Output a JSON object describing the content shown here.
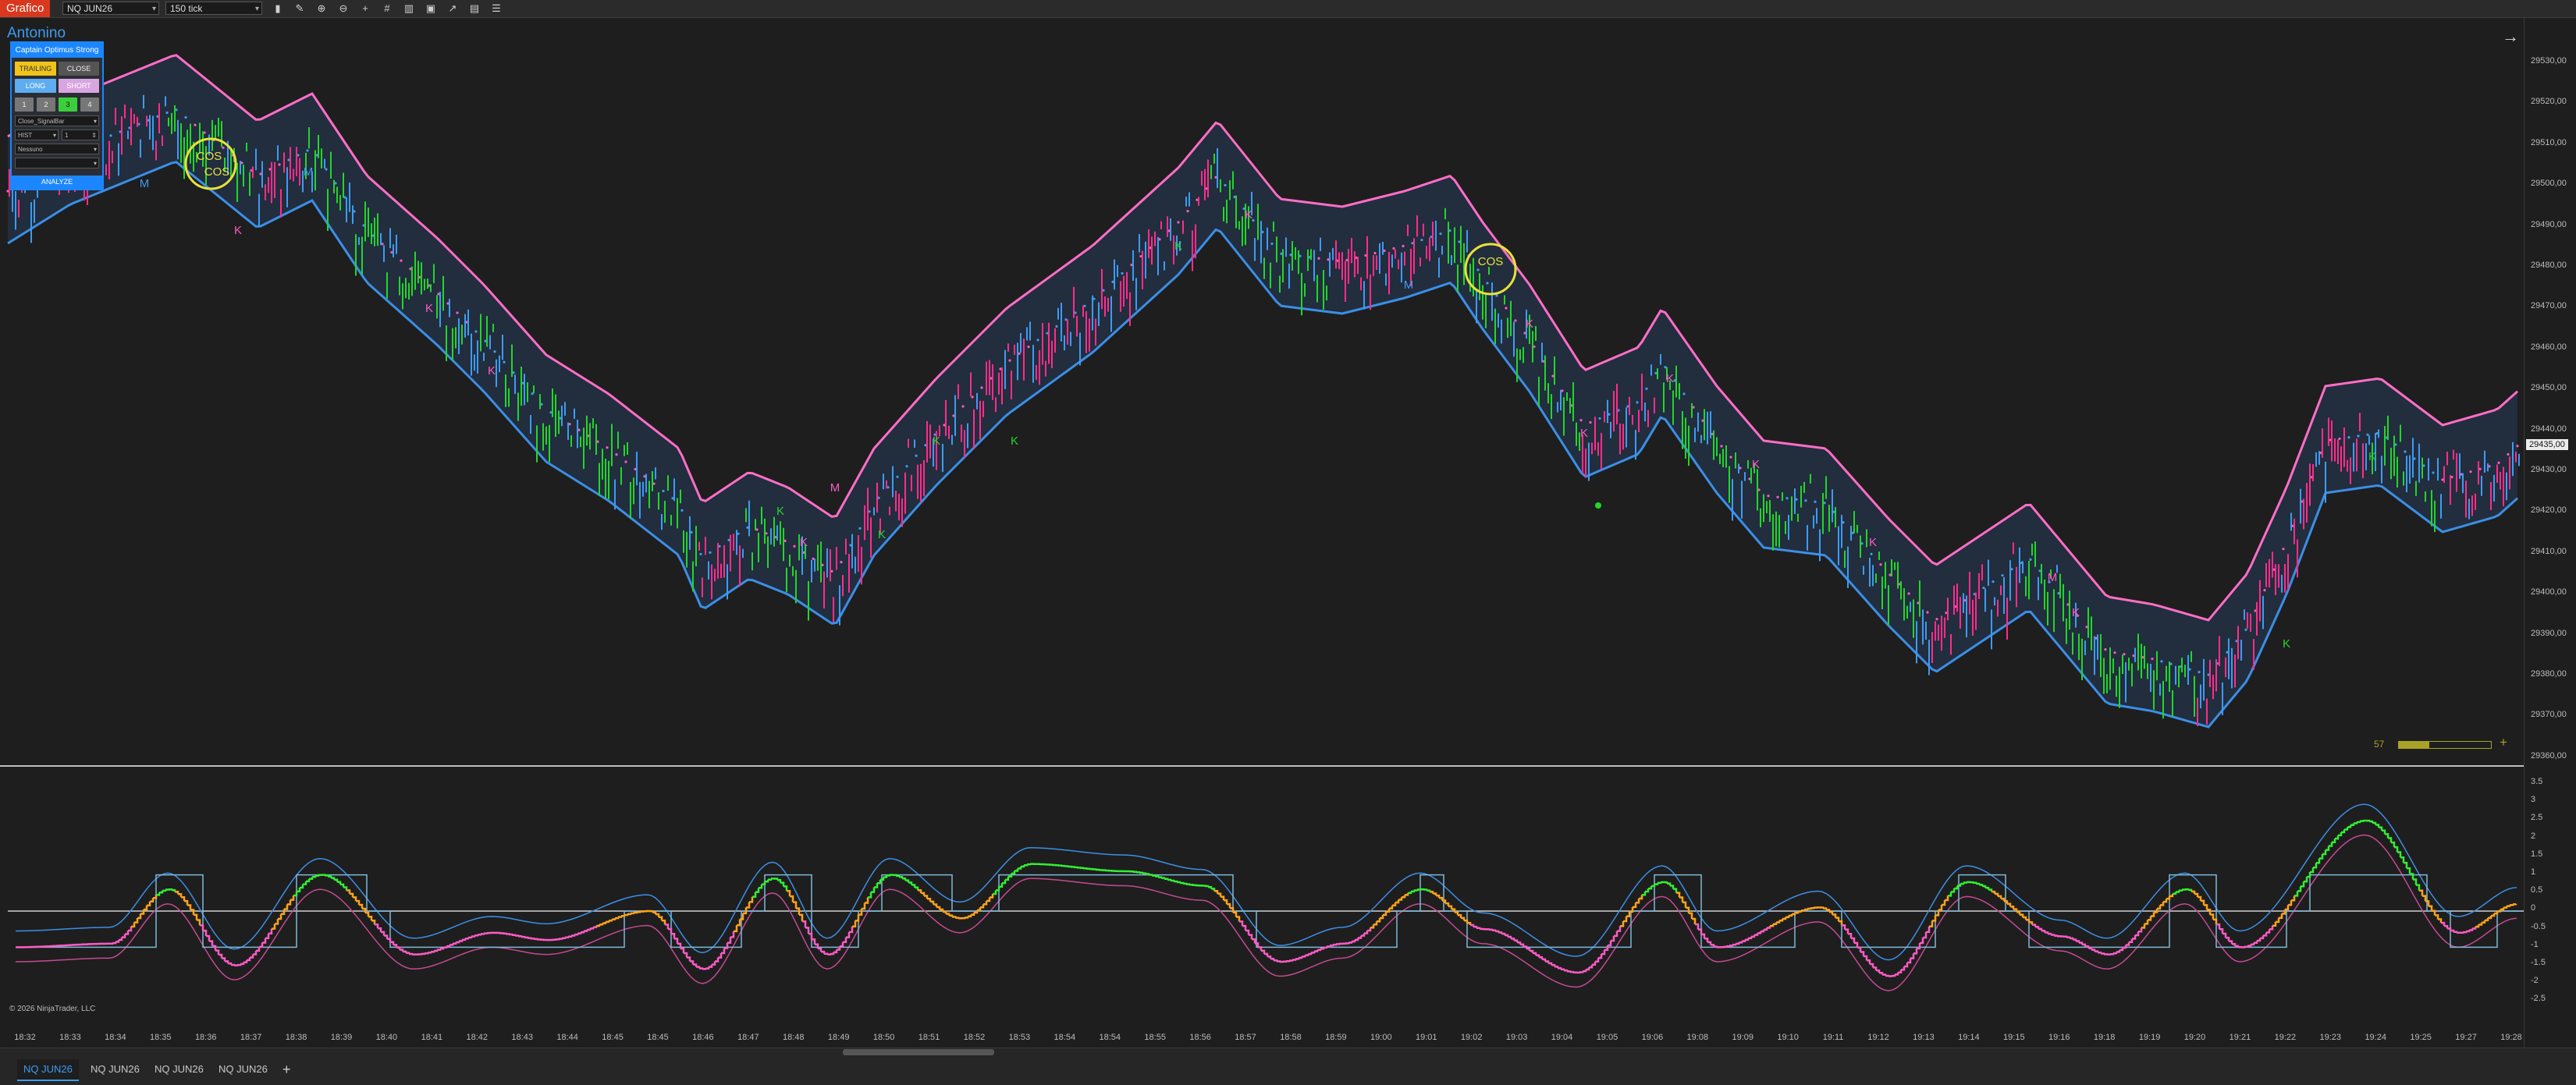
{
  "toolbar": {
    "app_button": "Grafico",
    "instrument": "NQ JUN26",
    "interval": "150 tick",
    "icons": [
      "bar-type-icon",
      "draw-pen-icon",
      "zoom-in-icon",
      "zoom-out-icon",
      "crosshair-icon",
      "hash-icon",
      "document-icon",
      "panel-icon",
      "screen-icon",
      "indicator-icon",
      "properties-icon",
      "list-icon"
    ]
  },
  "chart": {
    "account_label": "Antonino",
    "copyright": "© 2026 NinjaTrader, LLC",
    "y_axis_main": [
      "29530,00",
      "29520,00",
      "29510,00",
      "29500,00",
      "29490,00",
      "29480,00",
      "29470,00",
      "29460,00",
      "29450,00",
      "29440,00",
      "29430,00",
      "29420,00",
      "29410,00",
      "29400,00",
      "29390,00",
      "29380,00",
      "29370,00",
      "29360,00"
    ],
    "current_price": "29435,00",
    "y_axis_osc": [
      "3.5",
      "3",
      "2.5",
      "2",
      "1.5",
      "1",
      "0.5",
      "0",
      "-0.5",
      "-1",
      "-1.5",
      "-2",
      "-2.5"
    ],
    "x_axis": [
      "18:32",
      "18:33",
      "18:34",
      "18:35",
      "18:36",
      "18:37",
      "18:38",
      "18:39",
      "18:40",
      "18:41",
      "18:42",
      "18:43",
      "18:44",
      "18:45",
      "18:45",
      "18:46",
      "18:47",
      "18:48",
      "18:49",
      "18:50",
      "18:51",
      "18:52",
      "18:53",
      "18:54",
      "18:54",
      "18:55",
      "18:56",
      "18:57",
      "18:58",
      "18:59",
      "19:00",
      "19:01",
      "19:02",
      "19:03",
      "19:04",
      "19:05",
      "19:06",
      "19:08",
      "19:09",
      "19:10",
      "19:11",
      "19:12",
      "19:13",
      "19:14",
      "19:15",
      "19:16",
      "19:18",
      "19:19",
      "19:20",
      "19:21",
      "19:22",
      "19:23",
      "19:24",
      "19:25",
      "19:27",
      "19:28"
    ],
    "volume_counter": "57",
    "volume_fill_fraction": 0.33,
    "markers": {
      "cos": [
        "COS",
        "COS",
        "COS"
      ],
      "k": "K",
      "m": "M"
    },
    "colors": {
      "upper_band": "#ff6ec7",
      "lower_band": "#3b8fe6",
      "bull": "#22d62a",
      "bear": "#ff2d8a",
      "neutral_blue": "#3d9cf2",
      "highlight": "#e8e23a",
      "osc_green": "#33ee33",
      "osc_orange": "#ffa31a",
      "osc_pink": "#ff5bc4"
    }
  },
  "panel": {
    "title": "Captain Optimus Strong",
    "btn_trailing": "TRAILING",
    "btn_close": "CLOSE",
    "btn_long": "LONG",
    "btn_short": "SHORT",
    "qty": [
      "1",
      "2",
      "3",
      "4"
    ],
    "dropdown1": "Close_SignalBar",
    "dropdown2": "HIST",
    "dropdown2_value": "1",
    "dropdown3": "Nessuno",
    "analyze": "ANALYZE"
  },
  "tabs": [
    "NQ JUN26",
    "NQ JUN26",
    "NQ JUN26",
    "NQ JUN26"
  ],
  "add_tab": "+"
}
